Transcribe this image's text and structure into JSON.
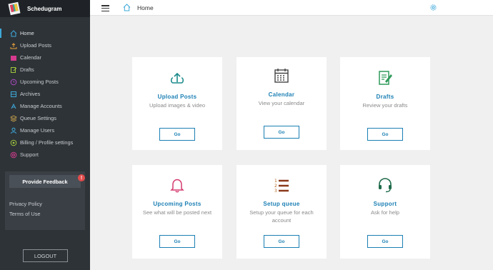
{
  "app": {
    "name": "Schedugram"
  },
  "sidebar": {
    "items": [
      {
        "label": "Home",
        "icon": "home-icon",
        "color": "#3ea9d9"
      },
      {
        "label": "Upload Posts",
        "icon": "upload-icon",
        "color": "#e8a13a"
      },
      {
        "label": "Calendar",
        "icon": "calendar-icon",
        "color": "#d63b8f"
      },
      {
        "label": "Drafts",
        "icon": "drafts-icon",
        "color": "#9ec63b"
      },
      {
        "label": "Upcoming Posts",
        "icon": "bell-icon",
        "color": "#b04bc7"
      },
      {
        "label": "Archives",
        "icon": "archive-icon",
        "color": "#3ea9d9"
      },
      {
        "label": "Manage Accounts",
        "icon": "accounts-icon",
        "color": "#3ea9d9"
      },
      {
        "label": "Queue Settings",
        "icon": "queue-icon",
        "color": "#c9a24b"
      },
      {
        "label": "Manage Users",
        "icon": "user-icon",
        "color": "#3ea9d9"
      },
      {
        "label": "Billing / Profile settings",
        "icon": "billing-icon",
        "color": "#9ec63b"
      },
      {
        "label": "Support",
        "icon": "support-icon",
        "color": "#d63b8f"
      }
    ],
    "feedback_label": "Provide Feedback",
    "feedback_badge": "!",
    "privacy_label": "Privacy Policy",
    "terms_label": "Terms of Use",
    "logout_label": "LOGOUT"
  },
  "header": {
    "breadcrumb": "Home"
  },
  "cards": [
    {
      "title": "Upload Posts",
      "subtitle": "Upload images & video",
      "button": "Go",
      "icon": "upload-cloud-icon"
    },
    {
      "title": "Calendar",
      "subtitle": "View your calendar",
      "button": "Go",
      "icon": "calendar-icon"
    },
    {
      "title": "Drafts",
      "subtitle": "Review your drafts",
      "button": "Go",
      "icon": "drafts-icon"
    },
    {
      "title": "Upcoming Posts",
      "subtitle": "See what will be posted next",
      "button": "Go",
      "icon": "bell-icon"
    },
    {
      "title": "Setup queue",
      "subtitle": "Setup your queue for each account",
      "button": "Go",
      "icon": "queue-list-icon"
    },
    {
      "title": "Support",
      "subtitle": "Ask for help",
      "button": "Go",
      "icon": "headset-icon"
    }
  ],
  "colors": {
    "accent": "#1b7fb4",
    "sidebar_bg": "#2e3338",
    "badge": "#e24b4b"
  }
}
